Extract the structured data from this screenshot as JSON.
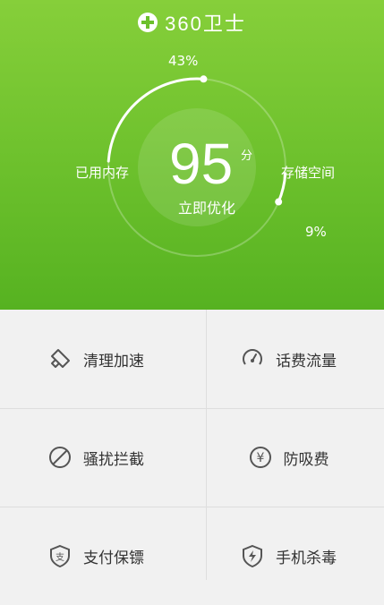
{
  "brand": {
    "logo_text": "360卫士",
    "icon": "plus-circle-icon"
  },
  "score": {
    "value": "95",
    "unit": "分",
    "action": "立即优化"
  },
  "memory": {
    "label": "已用内存",
    "percent_text": "43%",
    "fraction": 0.43
  },
  "storage": {
    "label": "存储空间",
    "percent_text": "9%",
    "fraction": 0.09
  },
  "tiles": [
    {
      "label": "清理加速",
      "icon": "broom-icon"
    },
    {
      "label": "话费流量",
      "icon": "speedometer-icon"
    },
    {
      "label": "骚扰拦截",
      "icon": "block-icon"
    },
    {
      "label": "防吸费",
      "icon": "yen-circle-icon"
    },
    {
      "label": "支付保镖",
      "icon": "pay-shield-icon"
    },
    {
      "label": "手机杀毒",
      "icon": "lightning-shield-icon"
    }
  ],
  "colors": {
    "green_top": "#86cf3a",
    "green_bottom": "#56b221",
    "tile_bg": "#f1f1f1",
    "icon": "#555555"
  }
}
